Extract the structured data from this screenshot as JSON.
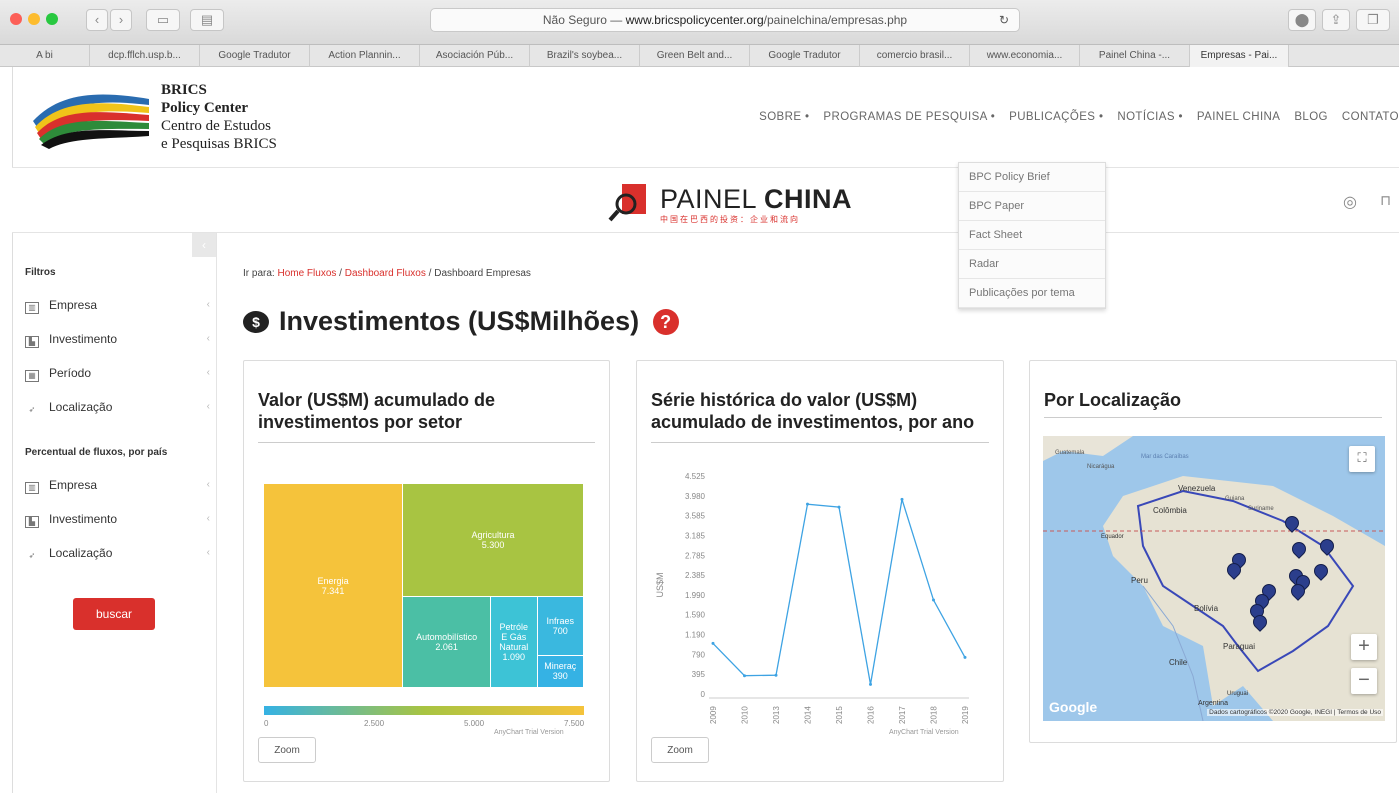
{
  "browser": {
    "url_prefix": "Não Seguro — ",
    "url_domain": "www.bricspolicycenter.org",
    "url_path": "/painelchina/empresas.php",
    "bookmarks": [
      "A bi",
      "dcp.fflch.usp.b...",
      "Google Tradutor",
      "Action Plannin...",
      "Asociación Púb...",
      "Brazil's soybea...",
      "Green Belt and...",
      "Google Tradutor",
      "comercio brasil...",
      "www.economia...",
      "Painel China -...",
      "Empresas - Pai..."
    ]
  },
  "site": {
    "brand_line1": "BRICS",
    "brand_line2": "Policy Center",
    "brand_line3": "Centro de Estudos",
    "brand_line4": "e Pesquisas BRICS",
    "nav": [
      "SOBRE •",
      "PROGRAMAS DE PESQUISA •",
      "PUBLICAÇÕES •",
      "NOTÍCIAS •",
      "PAINEL CHINA",
      "BLOG",
      "CONTATO"
    ],
    "dropdown": [
      "BPC Policy Brief",
      "BPC Paper",
      "Fact Sheet",
      "Radar",
      "Publicações por tema"
    ]
  },
  "painel": {
    "title_light": "PAINEL ",
    "title_bold": "CHINA",
    "subtitle": "中国在巴西的投资：企业和流向"
  },
  "sidebar": {
    "filters_head": "Filtros",
    "filters": [
      "Empresa",
      "Investimento",
      "Período",
      "Localização"
    ],
    "pct_head": "Percentual de fluxos, por país",
    "pct": [
      "Empresa",
      "Investimento",
      "Localização"
    ],
    "buscar": "buscar"
  },
  "crumb": {
    "prefix": "Ir para:",
    "l1": "Home Fluxos",
    "sep": "/",
    "l2": "Dashboard Fluxos",
    "current": "Dashboard Empresas"
  },
  "page_title": "Investimentos (US$Milhões)",
  "card1": {
    "title": "Valor (US$M) acumulado de investimentos por setor",
    "zoom": "Zoom",
    "watermark": "AnyChart Trial Version",
    "scale_ticks": [
      "0",
      "2.500",
      "5.000",
      "7.500"
    ]
  },
  "card2": {
    "title": "Série histórica do valor (US$M) acumulado de investimentos, por ano",
    "zoom": "Zoom",
    "watermark": "AnyChart Trial Version"
  },
  "card3": {
    "title": "Por Localização",
    "google": "Google",
    "attribution": "Dados cartográficos ©2020 Google, INEGI | Termos de Uso",
    "labels": [
      "Venezuela",
      "Colômbia",
      "Equador",
      "Peru",
      "Bolívia",
      "Paraguai",
      "Chile",
      "Uruguai",
      "Argentina",
      "Guatemala",
      "Nicarágua",
      "Mar das Caraíbas",
      "Guiana",
      "Suriname"
    ]
  },
  "chart_data": [
    {
      "type": "treemap",
      "title": "Valor (US$M) acumulado de investimentos por setor",
      "categories": [
        "Energia",
        "Agricultura",
        "Automobilístico",
        "Petróle E Gás Natural",
        "Infraes",
        "Mineraç"
      ],
      "labels": [
        "Energia",
        "Agricultura",
        "Automobilístico",
        "Petróle\nE Gás\nNatural",
        "Infraes",
        "Mineraç"
      ],
      "values": [
        7341,
        5300,
        2061,
        1090,
        700,
        390
      ],
      "value_labels": [
        "7.341",
        "5.300",
        "2.061",
        "1.090",
        "700",
        "390"
      ],
      "colors": [
        "#f5c33b",
        "#a8c442",
        "#4bbfa5",
        "#3dc3d6",
        "#3ab8df",
        "#35b2e4"
      ],
      "scale_range": [
        0,
        7500
      ]
    },
    {
      "type": "line",
      "title": "Série histórica do valor (US$M) acumulado de investimentos, por ano",
      "x": [
        "2009",
        "2010",
        "2013",
        "2014",
        "2015",
        "2016",
        "2017",
        "2018",
        "2019"
      ],
      "values": [
        1050,
        380,
        390,
        3940,
        3880,
        200,
        4040,
        1950,
        760
      ],
      "y_ticks": [
        "4.525",
        "3.980",
        "3.585",
        "3.185",
        "2.785",
        "2.385",
        "1.990",
        "1.590",
        "1.190",
        "790",
        "395",
        "0"
      ],
      "ylabel": "US$M",
      "ylim": [
        0,
        4525
      ],
      "grid": false,
      "color": "#3ea3e3"
    }
  ]
}
